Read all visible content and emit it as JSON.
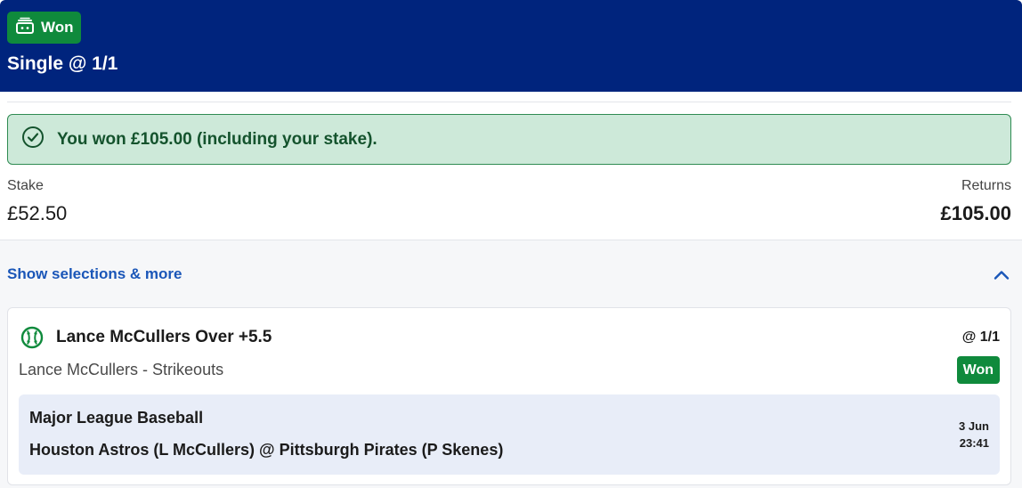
{
  "header": {
    "status_label": "Won",
    "status_icon": "ticket-icon",
    "title": "Single @ 1/1",
    "background_color": "#00247d",
    "status_color": "#0f8a3c"
  },
  "banner": {
    "icon": "check-circle-icon",
    "text": "You won £105.00 (including your stake).",
    "background_color": "#cde9d9"
  },
  "summary": {
    "stake_label": "Stake",
    "stake_value": "£52.50",
    "returns_label": "Returns",
    "returns_value": "£105.00"
  },
  "selections_toggle": {
    "label": "Show selections & more",
    "icon": "chevron-up-icon",
    "link_color": "#1a56b8"
  },
  "selection": {
    "sport_icon": "baseball-icon",
    "title": "Lance McCullers Over +5.5",
    "odds": "@ 1/1",
    "market": "Lance McCullers - Strikeouts",
    "result": "Won",
    "event": {
      "league": "Major League Baseball",
      "name": "Houston Astros (L McCullers) @ Pittsburgh Pirates (P Skenes)",
      "date": "3 Jun",
      "time": "23:41"
    }
  }
}
